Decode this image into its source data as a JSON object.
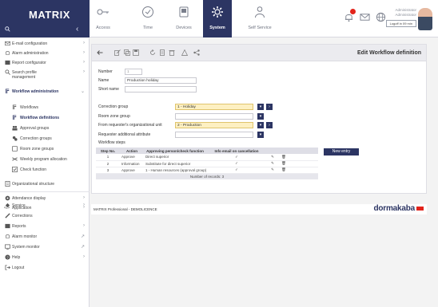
{
  "brand": {
    "logo": "MATRIX"
  },
  "nav": {
    "tabs": [
      {
        "label": "Access",
        "icon": "key-icon"
      },
      {
        "label": "Time",
        "icon": "clock-icon"
      },
      {
        "label": "Devices",
        "icon": "device-icon"
      },
      {
        "label": "System",
        "icon": "gear-icon",
        "active": true
      },
      {
        "label": "Self Service",
        "icon": "person-icon"
      }
    ]
  },
  "user": {
    "line1": "Administrator",
    "line2": "Administrator",
    "logout": "Logoff in 09 min"
  },
  "sidebar": {
    "items": [
      {
        "label": "E-mail configuration",
        "icon": "mail-icon"
      },
      {
        "label": "Alarm administration",
        "icon": "bell-icon"
      },
      {
        "label": "Report configurator",
        "icon": "report-icon"
      },
      {
        "label": "Search profile management",
        "icon": "search-icon"
      },
      {
        "label": "Workflow administration",
        "icon": "workflow-icon"
      },
      {
        "label": "Workflows",
        "icon": "workflow-icon"
      },
      {
        "label": "Workflow definitions",
        "icon": "workflow-icon"
      },
      {
        "label": "Approval groups",
        "icon": "group-icon"
      },
      {
        "label": "Correction groups",
        "icon": "correction-icon"
      },
      {
        "label": "Room zone groups",
        "icon": "room-icon"
      },
      {
        "label": "Weekly program allocation",
        "icon": "shuffle-icon"
      },
      {
        "label": "Check function",
        "icon": "check-icon"
      },
      {
        "label": "Organizational structure",
        "icon": "org-icon"
      },
      {
        "label": "Attendance display",
        "icon": "display-icon"
      },
      {
        "label": "Application",
        "icon": "code-icon"
      },
      {
        "label": "Service",
        "icon": "service-icon"
      },
      {
        "label": "Corrections",
        "icon": "correction-icon"
      },
      {
        "label": "Reports",
        "icon": "report-icon"
      },
      {
        "label": "Alarm monitor",
        "icon": "bell-icon"
      },
      {
        "label": "System monitor",
        "icon": "monitor-icon"
      },
      {
        "label": "Help",
        "icon": "help-icon"
      },
      {
        "label": "Logout",
        "icon": "logout-icon"
      }
    ]
  },
  "panel": {
    "title": "Edit Workflow definition",
    "number_label": "Number",
    "number_value": "1",
    "name_label": "Name",
    "name_value": "Production holiday",
    "shortname_label": "Short name",
    "shortname_value": "",
    "correction_group_label": "Correction group",
    "correction_group_value": "1 - Holiday",
    "room_zone_label": "Room zone group",
    "room_zone_value": "",
    "org_unit_label": "From requester's organizational unit",
    "org_unit_value": "2 - Production",
    "req_attr_label": "Requester additional attribute",
    "req_attr_value": "",
    "steps_title": "Workflow steps",
    "new_entry": "New entry"
  },
  "steps": {
    "headers": [
      "Step No.",
      "Action",
      "Approving person/check function",
      "Info email on cancellation"
    ],
    "rows": [
      {
        "no": "1",
        "action": "Approve",
        "person": "Direct superior",
        "info": "✓"
      },
      {
        "no": "2",
        "action": "Information",
        "person": "Substitute for direct superior",
        "info": "✓"
      },
      {
        "no": "3",
        "action": "Approve",
        "person": "1 - Human resources (approval group)",
        "info": "✓"
      }
    ],
    "footer": "Number of records: 3"
  },
  "footer": {
    "text": "MATRIX Professional - DEMOLICENCE",
    "logo": "dormakaba"
  },
  "colors": {
    "brand": "#2c3563",
    "highlight": "#fdf0c2",
    "alert": "#e2231a"
  }
}
